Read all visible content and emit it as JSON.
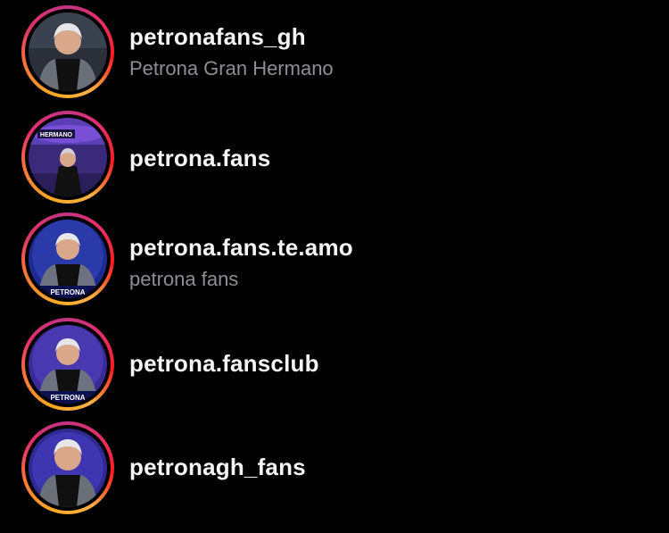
{
  "results": [
    {
      "username": "petronafans_gh",
      "full_name": "Petrona Gran Hermano",
      "avatar": "woman-portrait-icon",
      "avatar_bg": "#2a2f3a"
    },
    {
      "username": "petrona.fans",
      "full_name": "",
      "avatar": "woman-on-set-icon",
      "avatar_bg": "#3b2a7a",
      "badge_text": "HERMANO"
    },
    {
      "username": "petrona.fans.te.amo",
      "full_name": "petrona fans",
      "avatar": "woman-portrait-branded-icon",
      "avatar_bg": "#1d2a8f",
      "badge_text": "PETRONA"
    },
    {
      "username": "petrona.fansclub",
      "full_name": "",
      "avatar": "woman-portrait-branded-icon",
      "avatar_bg": "#3a2a95",
      "badge_text": "PETRONA"
    },
    {
      "username": "petronagh_fans",
      "full_name": "",
      "avatar": "woman-portrait-icon",
      "avatar_bg": "#2e2a90"
    }
  ],
  "colors": {
    "background": "#000000",
    "username": "#f5f5f5",
    "subtitle": "#8e8e93",
    "story_ring": [
      "#f9a825",
      "#e1306c",
      "#c13584"
    ]
  }
}
